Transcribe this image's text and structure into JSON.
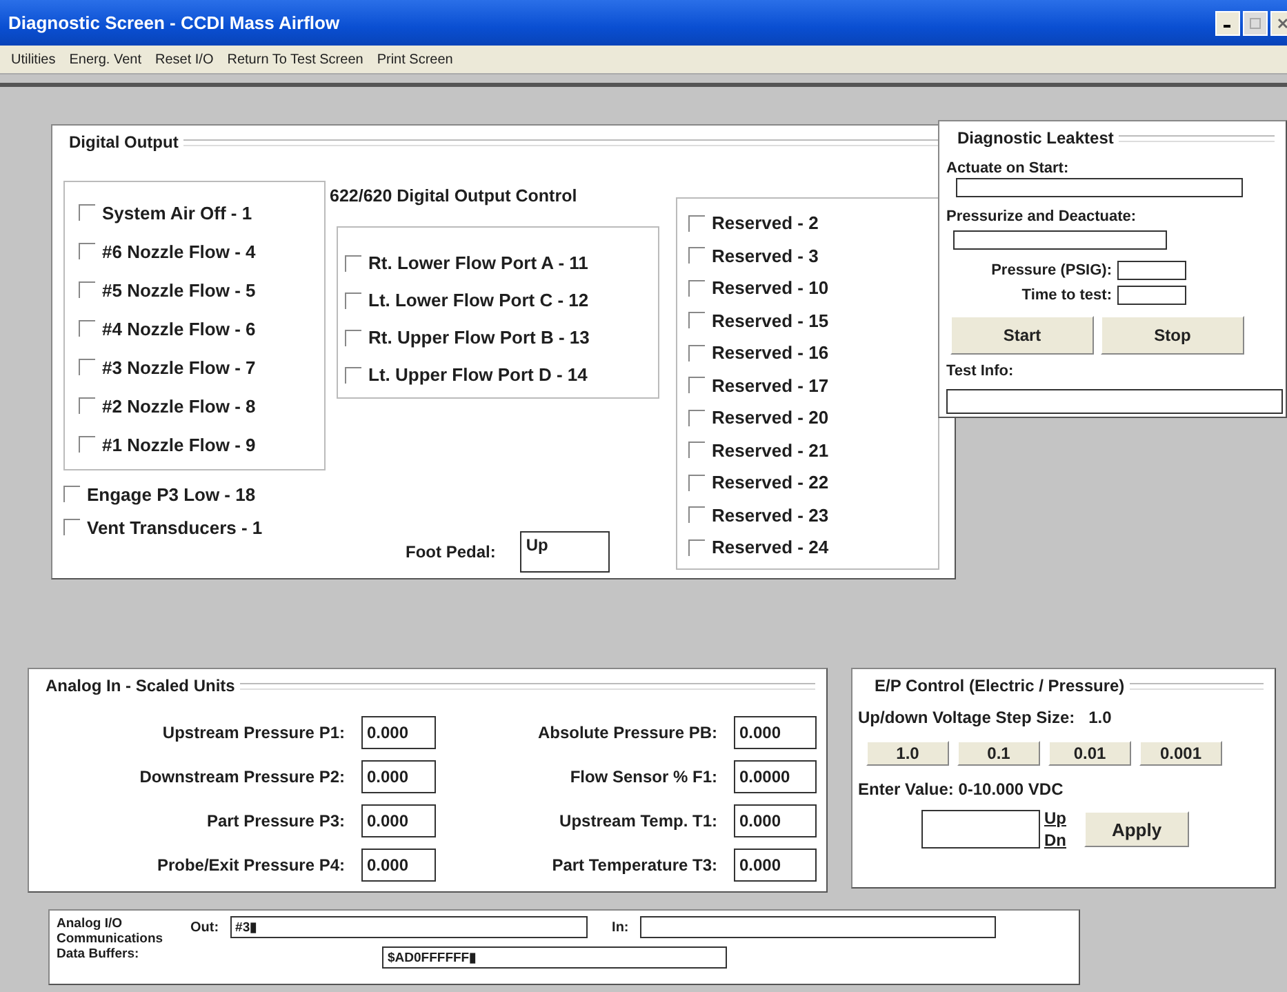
{
  "window": {
    "title": "Diagnostic Screen - CCDI Mass Airflow"
  },
  "menu": [
    "Utilities",
    "Energ. Vent",
    "Reset I/O",
    "Return To Test Screen",
    "Print Screen"
  ],
  "digital_output": {
    "title": "Digital Output",
    "nozzle_group": [
      {
        "label": "System Air Off -   1",
        "checked": false
      },
      {
        "label": "#6 Nozzle Flow - 4",
        "checked": false
      },
      {
        "label": "#5 Nozzle Flow - 5",
        "checked": false
      },
      {
        "label": "#4 Nozzle Flow - 6",
        "checked": false
      },
      {
        "label": "#3 Nozzle Flow - 7",
        "checked": false
      },
      {
        "label": "#2 Nozzle Flow - 8",
        "checked": false
      },
      {
        "label": "#1 Nozzle Flow - 9",
        "checked": false
      }
    ],
    "extra": [
      {
        "label": "Engage P3 Low - 18",
        "checked": false
      },
      {
        "label": "Vent Transducers - 1",
        "checked": false
      }
    ],
    "control_title": "622/620 Digital Output Control",
    "ports": [
      {
        "label": "Rt. Lower Flow Port A - 11",
        "checked": false
      },
      {
        "label": "Lt. Lower Flow Port C - 12",
        "checked": false
      },
      {
        "label": "Rt. Upper Flow Port B - 13",
        "checked": false
      },
      {
        "label": "Lt. Upper Flow Port D - 14",
        "checked": false
      }
    ],
    "foot_pedal": {
      "label": "Foot Pedal:",
      "value": "Up"
    },
    "reserved": [
      {
        "label": "Reserved - 2",
        "checked": false
      },
      {
        "label": "Reserved - 3",
        "checked": false
      },
      {
        "label": "Reserved - 10",
        "checked": false
      },
      {
        "label": "Reserved - 15",
        "checked": false
      },
      {
        "label": "Reserved - 16",
        "checked": false
      },
      {
        "label": "Reserved - 17",
        "checked": false
      },
      {
        "label": "Reserved - 20",
        "checked": false
      },
      {
        "label": "Reserved - 21",
        "checked": false
      },
      {
        "label": "Reserved - 22",
        "checked": false
      },
      {
        "label": "Reserved - 23",
        "checked": false
      },
      {
        "label": "Reserved - 24",
        "checked": false
      }
    ]
  },
  "leaktest": {
    "title": "Diagnostic Leaktest",
    "actuate_label": "Actuate on Start:",
    "pressurize_label": "Pressurize and Deactuate:",
    "pressure_label": "Pressure (PSIG):",
    "time_label": "Time to test:",
    "buttons": [
      "Start",
      "Stop"
    ],
    "test_info_label": "Test Info:"
  },
  "analog_in": {
    "title": "Analog In - Scaled Units",
    "readings": [
      {
        "label": "Upstream Pressure P1:",
        "value": "0.000"
      },
      {
        "label": "Absolute Pressure PB:",
        "value": "0.000"
      },
      {
        "label": "Downstream Pressure P2:",
        "value": "0.000"
      },
      {
        "label": "Flow Sensor % F1:",
        "value": "0.0000"
      },
      {
        "label": "Part Pressure P3:",
        "value": "0.000"
      },
      {
        "label": "Upstream Temp. T1:",
        "value": "0.000"
      },
      {
        "label": "Probe/Exit Pressure P4:",
        "value": "0.000"
      },
      {
        "label": "Part Temperature T3:",
        "value": "0.000"
      }
    ]
  },
  "ep_control": {
    "title": "E/P Control (Electric / Pressure)",
    "step_label": "Up/down Voltage Step Size:",
    "step_value": "1.0",
    "step_buttons": [
      "1.0",
      "0.1",
      "0.01",
      "0.001"
    ],
    "enter_label": "Enter Value:  0-10.000 VDC",
    "up": "Up",
    "dn": "Dn",
    "apply": "Apply"
  },
  "analog_io": {
    "label": "Analog I/O Communications Data Buffers:",
    "out_label": "Out:",
    "out_value": "#3▮",
    "in_label": "In:",
    "buffer_value": "$AD0FFFFFF▮"
  }
}
